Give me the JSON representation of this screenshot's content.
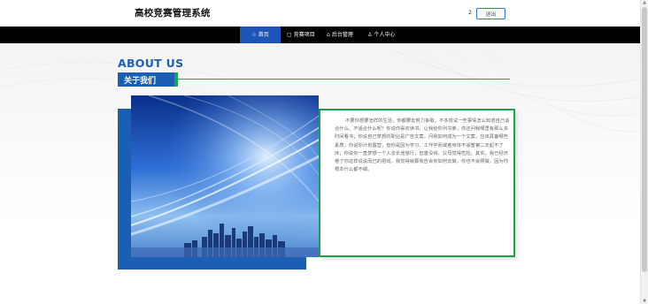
{
  "header": {
    "site_title": "高校竞赛管理系统",
    "user_indicator": "2",
    "logout_label": "退出"
  },
  "nav": {
    "items": [
      {
        "label": "首页",
        "icon": "home-icon",
        "active": true
      },
      {
        "label": "竞赛项目",
        "icon": "document-icon",
        "active": false
      },
      {
        "label": "后台管理",
        "icon": "briefcase-icon",
        "active": false
      },
      {
        "label": "个人中心",
        "icon": "user-icon",
        "active": false
      }
    ]
  },
  "about": {
    "title_en": "ABOUT US",
    "title_cn": "关于我们",
    "body": "不要你想要怎样的生活，你都要去努力争取，不多尝试一些事情怎么知道自己适合什么、不适合什么呢？你说你喜欢读书，让我给你列书单，你还问我哪里有那么多时间看书；你说自己梦想的职业是广告文案，问我如何成为一个文案，应该具备哪些素质；你说你计划露营，但你是因为学习、工作学而或者身体不适暂第二天起不了床；你说你一直梦想一个人去长途旅行，但害没钱、父母觉得危险。其实，我已经厌倦了你这样说说而已的把戏，我觉得就算我告诉你如何去做，你也不会照做，因为你根本什么都不做。"
  },
  "colors": {
    "brand_blue": "#1a5fb4",
    "accent_green": "#1aa34a",
    "nav_bg": "#000000",
    "nav_active": "#1d56b8"
  }
}
